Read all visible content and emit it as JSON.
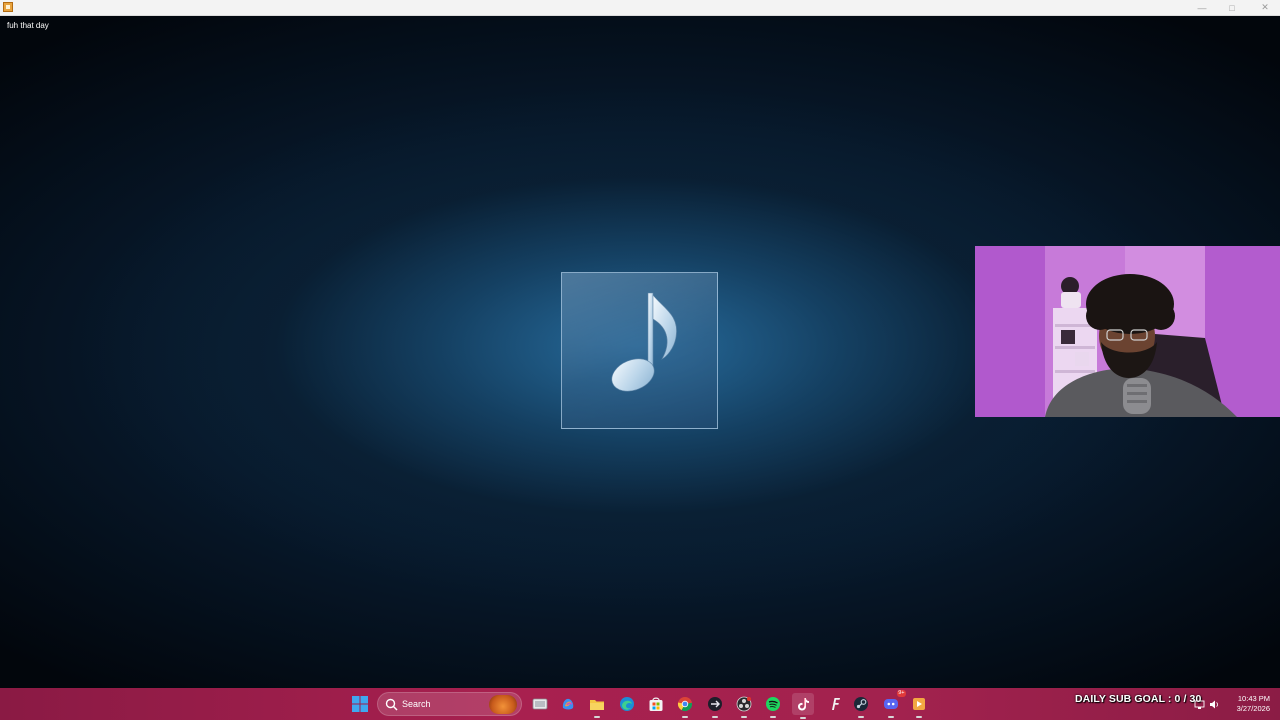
{
  "window": {
    "app_icon": "media-player-icon",
    "controls": [
      "minimize-icon",
      "maximize-icon",
      "close-icon"
    ]
  },
  "player": {
    "now_playing_title": "fuh that day",
    "art_icon": "music-note-icon"
  },
  "webcam": {
    "description_icon": "webcam-overlay"
  },
  "taskbar": {
    "search_label": "Search",
    "pinned": [
      "start-icon",
      "task-view-icon",
      "copilot-icon",
      "file-explorer-icon",
      "edge-icon",
      "microsoft-store-icon",
      "chrome-icon",
      "app-icon",
      "obs-icon",
      "spotify-icon",
      "tiktok-icon",
      "font-app-icon",
      "steam-icon",
      "discord-icon",
      "media-player-icon"
    ],
    "discord_badge": "9+",
    "overlay_text": "DAILY SUB GOAL : 0 / 30",
    "clock_time": "10:43 PM",
    "clock_date": "3/27/2026"
  },
  "colors": {
    "taskbar": "#a8204f",
    "player_glow": "#286ea0",
    "webcam_bg": "#d98ce8"
  }
}
